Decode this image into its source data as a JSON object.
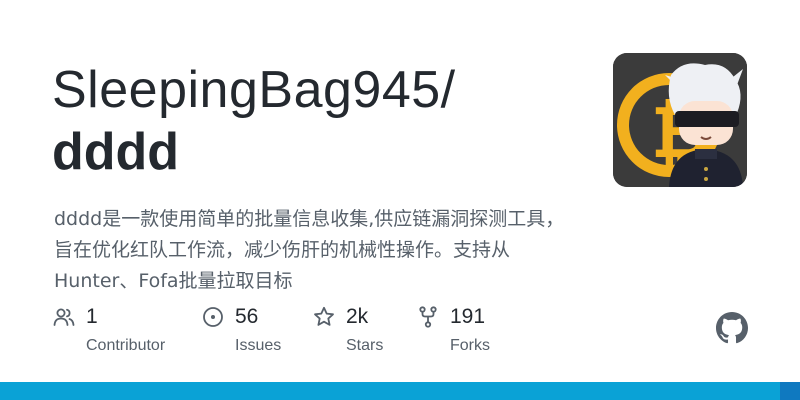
{
  "repo": {
    "owner_prefix": "SleepingBag945/",
    "name": "dddd",
    "description": "dddd是一款使用简单的批量信息收集,供应链漏洞探测工具，旨在优化红队工作流，减少伤肝的机械性操作。支持从Hunter、Fofa批量拉取目标"
  },
  "stats": [
    {
      "value": "1",
      "label": "Contributor",
      "icon": "people-icon"
    },
    {
      "value": "56",
      "label": "Issues",
      "icon": "issue-icon"
    },
    {
      "value": "2k",
      "label": "Stars",
      "icon": "star-icon"
    },
    {
      "value": "191",
      "label": "Forks",
      "icon": "fork-icon"
    }
  ],
  "avatar_icon": "anime-character-bitcoin-avatar",
  "brand_icon": "github-mark-icon",
  "colors": {
    "text_primary": "#24292f",
    "text_secondary": "#57606a",
    "bottom_bar": "#0aa2d6",
    "bitcoin_gold": "#f2b01e"
  }
}
